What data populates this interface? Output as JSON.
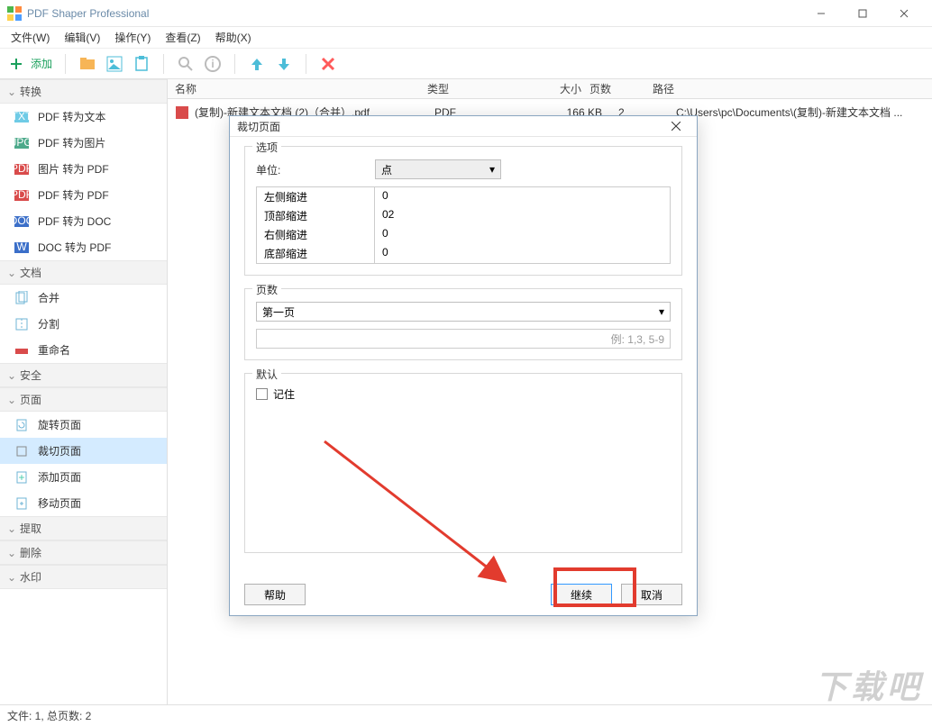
{
  "window": {
    "title": "PDF Shaper Professional"
  },
  "menu": {
    "file": "文件(W)",
    "edit": "编辑(V)",
    "operate": "操作(Y)",
    "view": "查看(Z)",
    "help": "帮助(X)"
  },
  "toolbar": {
    "add": "添加"
  },
  "sidebar": {
    "cat_convert": "转换",
    "convert_items": [
      "PDF 转为文本",
      "PDF 转为图片",
      "图片 转为 PDF",
      "PDF 转为 PDF",
      "PDF 转为 DOC",
      "DOC 转为 PDF"
    ],
    "cat_doc": "文档",
    "doc_items": [
      "合并",
      "分割",
      "重命名"
    ],
    "cat_security": "安全",
    "cat_page": "页面",
    "page_items": [
      "旋转页面",
      "裁切页面",
      "添加页面",
      "移动页面"
    ],
    "cat_extract": "提取",
    "cat_delete": "删除",
    "cat_watermark": "水印"
  },
  "columns": {
    "name": "名称",
    "type": "类型",
    "size": "大小",
    "pages": "页数",
    "path": "路径"
  },
  "file": {
    "name": "(复制)-新建文本文档 (2)（合并）.pdf",
    "type": "PDF",
    "size": "166 KB",
    "pages": "2",
    "path": "C:\\Users\\pc\\Documents\\(复制)-新建文本文档 ..."
  },
  "status": "文件: 1, 总页数: 2",
  "dialog": {
    "title": "裁切页面",
    "options_legend": "选项",
    "unit_label": "单位:",
    "unit_value": "点",
    "margins": {
      "left_label": "左侧缩进",
      "left_value": "0",
      "top_label": "顶部缩进",
      "top_value": "02",
      "right_label": "右侧缩进",
      "right_value": "0",
      "bottom_label": "底部缩进",
      "bottom_value": "0"
    },
    "pages_legend": "页数",
    "pages_value": "第一页",
    "pages_placeholder": "例: 1,3, 5-9",
    "default_legend": "默认",
    "remember_label": "记住",
    "help_btn": "帮助",
    "continue_btn": "继续",
    "cancel_btn": "取消"
  },
  "watermark": "下载吧"
}
